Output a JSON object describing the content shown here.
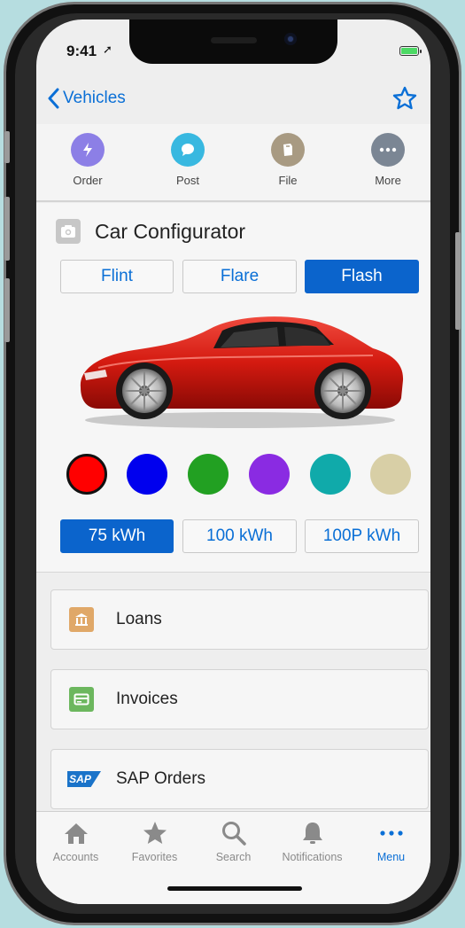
{
  "status_bar": {
    "time": "9:41",
    "location_glyph": "➚"
  },
  "nav": {
    "back_label": "Vehicles",
    "star_icon": "star-outline-icon"
  },
  "actions": [
    {
      "label": "Order",
      "icon": "lightning-icon",
      "color": "#8c7fe6"
    },
    {
      "label": "Post",
      "icon": "chat-bubble-icon",
      "color": "#38b8e0"
    },
    {
      "label": "File",
      "icon": "file-icon",
      "color": "#a89a82"
    },
    {
      "label": "More",
      "icon": "more-icon",
      "color": "#7b8694"
    }
  ],
  "configurator": {
    "title": "Car Configurator",
    "trims": [
      {
        "label": "Flint",
        "selected": false
      },
      {
        "label": "Flare",
        "selected": false
      },
      {
        "label": "Flash",
        "selected": true
      }
    ],
    "colors": [
      "#ff0000",
      "#0000ee",
      "#22a022",
      "#8a2be2",
      "#10aaaa",
      "#d8cfa6"
    ],
    "selected_color": "#ff0000",
    "batteries": [
      {
        "label": "75 kWh",
        "selected": true
      },
      {
        "label": "100 kWh",
        "selected": false
      },
      {
        "label": "100P kWh",
        "selected": false
      }
    ]
  },
  "list": [
    {
      "label": "Loans",
      "icon": "bank-icon",
      "color": "#e0a868"
    },
    {
      "label": "Invoices",
      "icon": "invoice-icon",
      "color": "#6cb75e"
    },
    {
      "label": "SAP Orders",
      "icon": "sap-logo-icon",
      "logo_text": "SAP",
      "color": "#1a73c9"
    }
  ],
  "tabs": [
    {
      "label": "Accounts",
      "icon": "home-icon",
      "active": false
    },
    {
      "label": "Favorites",
      "icon": "star-icon",
      "active": false
    },
    {
      "label": "Search",
      "icon": "search-icon",
      "active": false
    },
    {
      "label": "Notifications",
      "icon": "bell-icon",
      "active": false
    },
    {
      "label": "Menu",
      "icon": "more-dots-icon",
      "active": true
    }
  ]
}
